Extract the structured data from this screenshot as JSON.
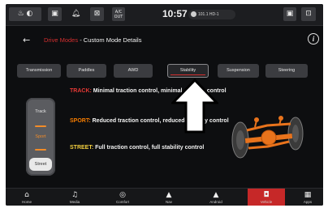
{
  "status_bar": {
    "clock": "10:57",
    "clock_sub": "",
    "radio": "101.1 HD-1",
    "air_label_top": "A/C",
    "air_label_bottom": "OUT",
    "icons": [
      "steering-heat-icon",
      "seat-heat-icon",
      "bell-icon",
      "heated-window-icon",
      "seat-heat-icon",
      "seat-cool-icon"
    ]
  },
  "header": {
    "back_icon": "←",
    "crumb_section": "Drive Modes",
    "crumb_separator": " - ",
    "crumb_page": "Custom Mode Details",
    "info_icon": "i"
  },
  "tabs": [
    {
      "label": "Transmission",
      "active": false
    },
    {
      "label": "Paddles",
      "active": false
    },
    {
      "label": "AWD",
      "active": false
    },
    {
      "label": "Stability",
      "active": true
    },
    {
      "label": "Suspension",
      "active": false
    },
    {
      "label": "Steering",
      "active": false
    }
  ],
  "mode_selector": {
    "items": [
      "Track",
      "Sport",
      "Street"
    ],
    "selected": "Street"
  },
  "descriptions": [
    {
      "key": "TRACK:",
      "text": " Minimal traction control, minimal stability control",
      "color": "#e53935"
    },
    {
      "key": "SPORT:",
      "text": " Reduced traction control, reduced stability control",
      "color": "#f57c00"
    },
    {
      "key": "STREET:",
      "text": " Full traction control, full stability control",
      "color": "#f4d03f"
    }
  ],
  "nav": [
    {
      "label": "Home",
      "icon": "⌂",
      "icon_name": "home-icon",
      "active": false
    },
    {
      "label": "Media",
      "icon": "♫",
      "icon_name": "music-icon",
      "active": false
    },
    {
      "label": "Comfort",
      "icon": "◎",
      "icon_name": "comfort-icon",
      "active": false
    },
    {
      "label": "Nav",
      "icon": "▲",
      "icon_name": "navigation-icon",
      "active": false
    },
    {
      "label": "Android",
      "icon": "▲",
      "icon_name": "android-auto-icon",
      "active": false
    },
    {
      "label": "Vehicle",
      "icon": "◘",
      "icon_name": "vehicle-icon",
      "active": true
    },
    {
      "label": "Apps",
      "icon": "▦",
      "icon_name": "apps-grid-icon",
      "active": false
    }
  ],
  "colors": {
    "accent_red": "#d32f2f",
    "nav_active": "#c62828",
    "axle_orange": "#e8731c"
  }
}
